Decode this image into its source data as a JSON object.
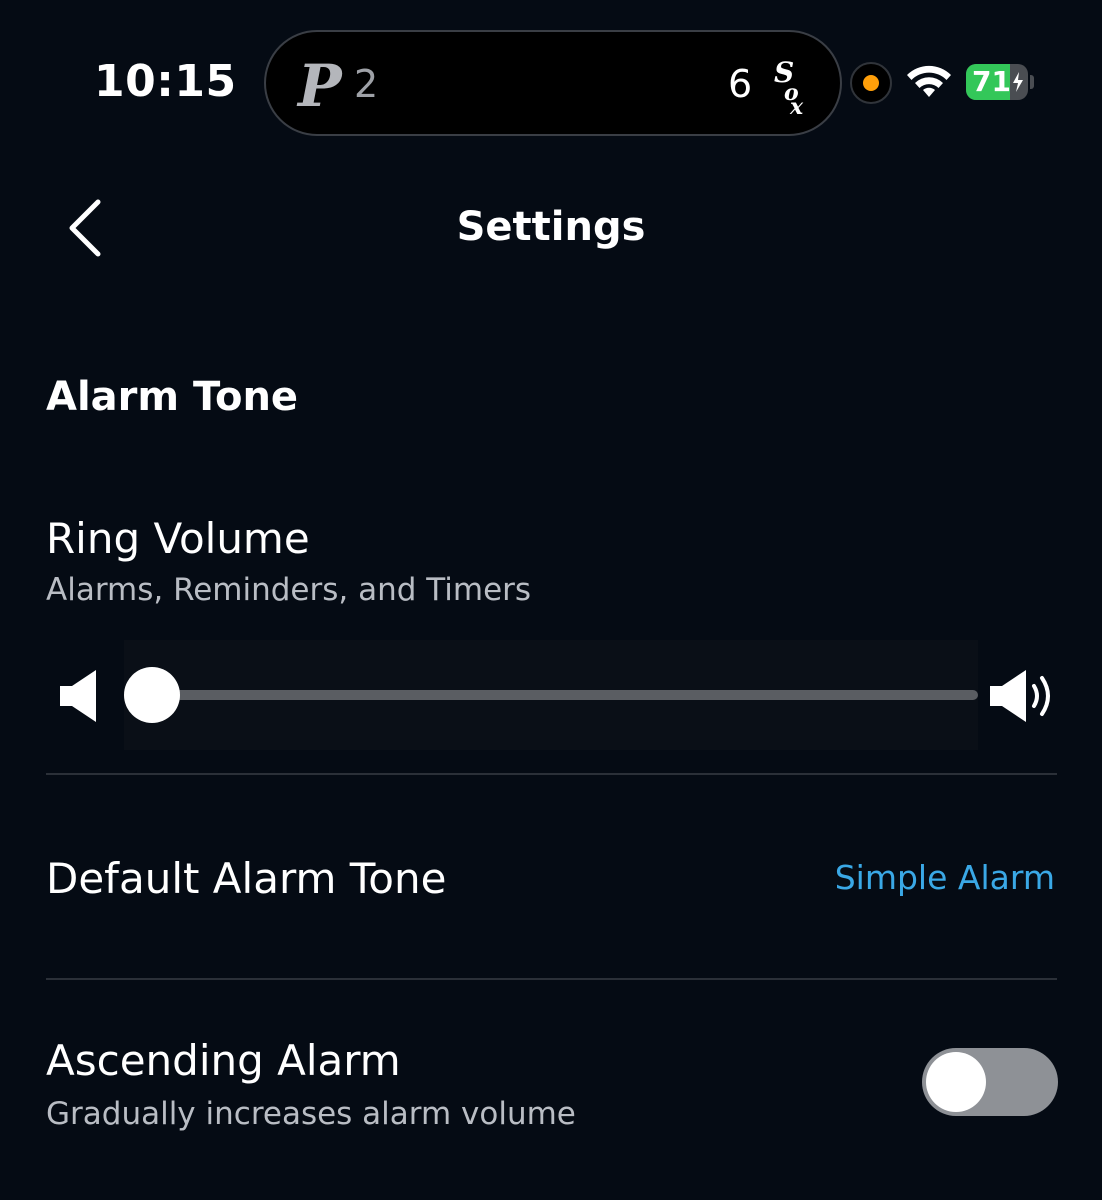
{
  "status_bar": {
    "time": "10:15",
    "live_activity": {
      "left_team_logo": "P",
      "left_score": "2",
      "right_score": "6",
      "right_team_logo": "Sox"
    },
    "battery_percent": "71",
    "battery_level": 0.71,
    "indicator_color": "#ff9f0a"
  },
  "nav": {
    "title": "Settings",
    "back_icon": "chevron-left-icon"
  },
  "alarm_tone": {
    "section_title": "Alarm Tone",
    "ring_volume": {
      "title": "Ring Volume",
      "subtitle": "Alarms, Reminders, and Timers",
      "level": 0,
      "low_icon": "speaker-low-icon",
      "high_icon": "speaker-high-icon"
    },
    "default_tone": {
      "title": "Default Alarm Tone",
      "value": "Simple Alarm"
    },
    "ascending": {
      "title": "Ascending Alarm",
      "subtitle": "Gradually increases alarm volume",
      "enabled": false
    }
  },
  "colors": {
    "background": "#050b14",
    "link": "#3aa8e6",
    "battery": "#33c759"
  }
}
